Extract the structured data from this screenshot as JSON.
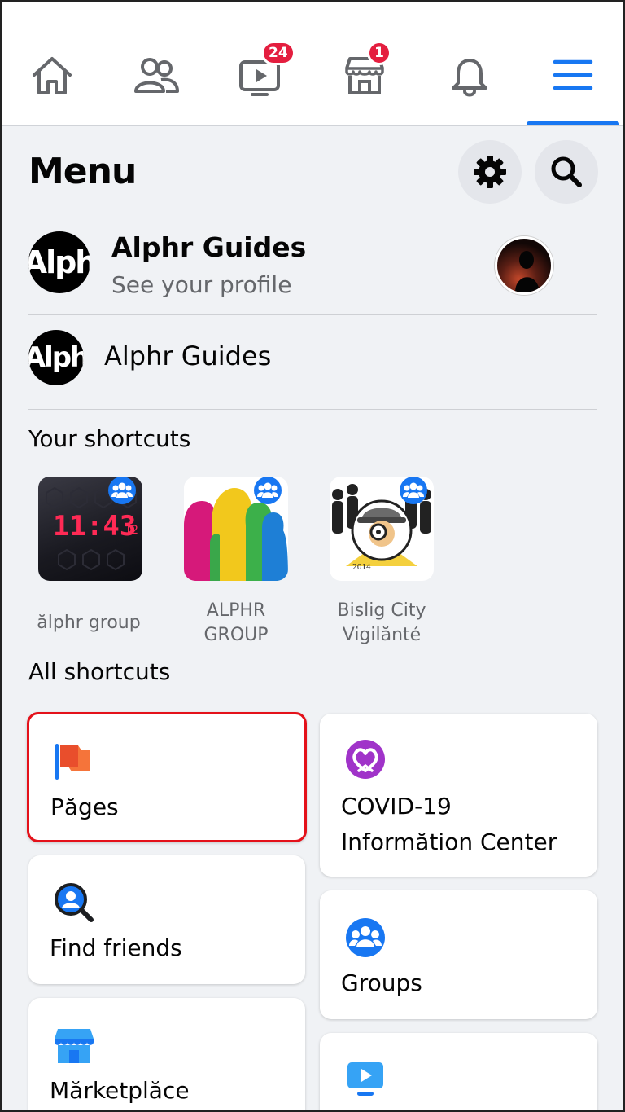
{
  "nav": {
    "items": [
      {
        "name": "home",
        "icon": "home-icon"
      },
      {
        "name": "friends",
        "icon": "friends-icon"
      },
      {
        "name": "watch",
        "icon": "watch-icon",
        "badge": "24"
      },
      {
        "name": "marketplace",
        "icon": "marketplace-icon",
        "badge": "1"
      },
      {
        "name": "notifications",
        "icon": "bell-icon"
      },
      {
        "name": "menu",
        "icon": "hamburger-icon",
        "active": true
      }
    ],
    "accent": "#1877f2",
    "badge_color": "#e41e3f"
  },
  "header": {
    "title": "Menu",
    "settings_icon": "gear-icon",
    "search_icon": "search-icon"
  },
  "profile": {
    "name": "Alphr Guides",
    "subtitle": "See your profile",
    "avatar_text": "Alph"
  },
  "page": {
    "name": "Alphr Guides",
    "avatar_text": "Alph"
  },
  "your_shortcuts": {
    "title": "Your shortcuts",
    "items": [
      {
        "label": "ălphr group",
        "thumb_text": "11:43"
      },
      {
        "label": "ALPHR GROUP"
      },
      {
        "label": "Bislig City Vigilănté"
      }
    ]
  },
  "all_shortcuts": {
    "title": "All shortcuts",
    "left": [
      {
        "label": "Păges",
        "icon": "flag-icon"
      },
      {
        "label": "Find friends",
        "icon": "find-friends-icon"
      },
      {
        "label": "Mărketplăce",
        "icon": "marketplace-store-icon"
      }
    ],
    "right": [
      {
        "label": "COVID-19 Informătion Center",
        "icon": "covid-heart-icon"
      },
      {
        "label": "Groups",
        "icon": "groups-icon"
      },
      {
        "label": "",
        "icon": "video-icon"
      }
    ]
  }
}
